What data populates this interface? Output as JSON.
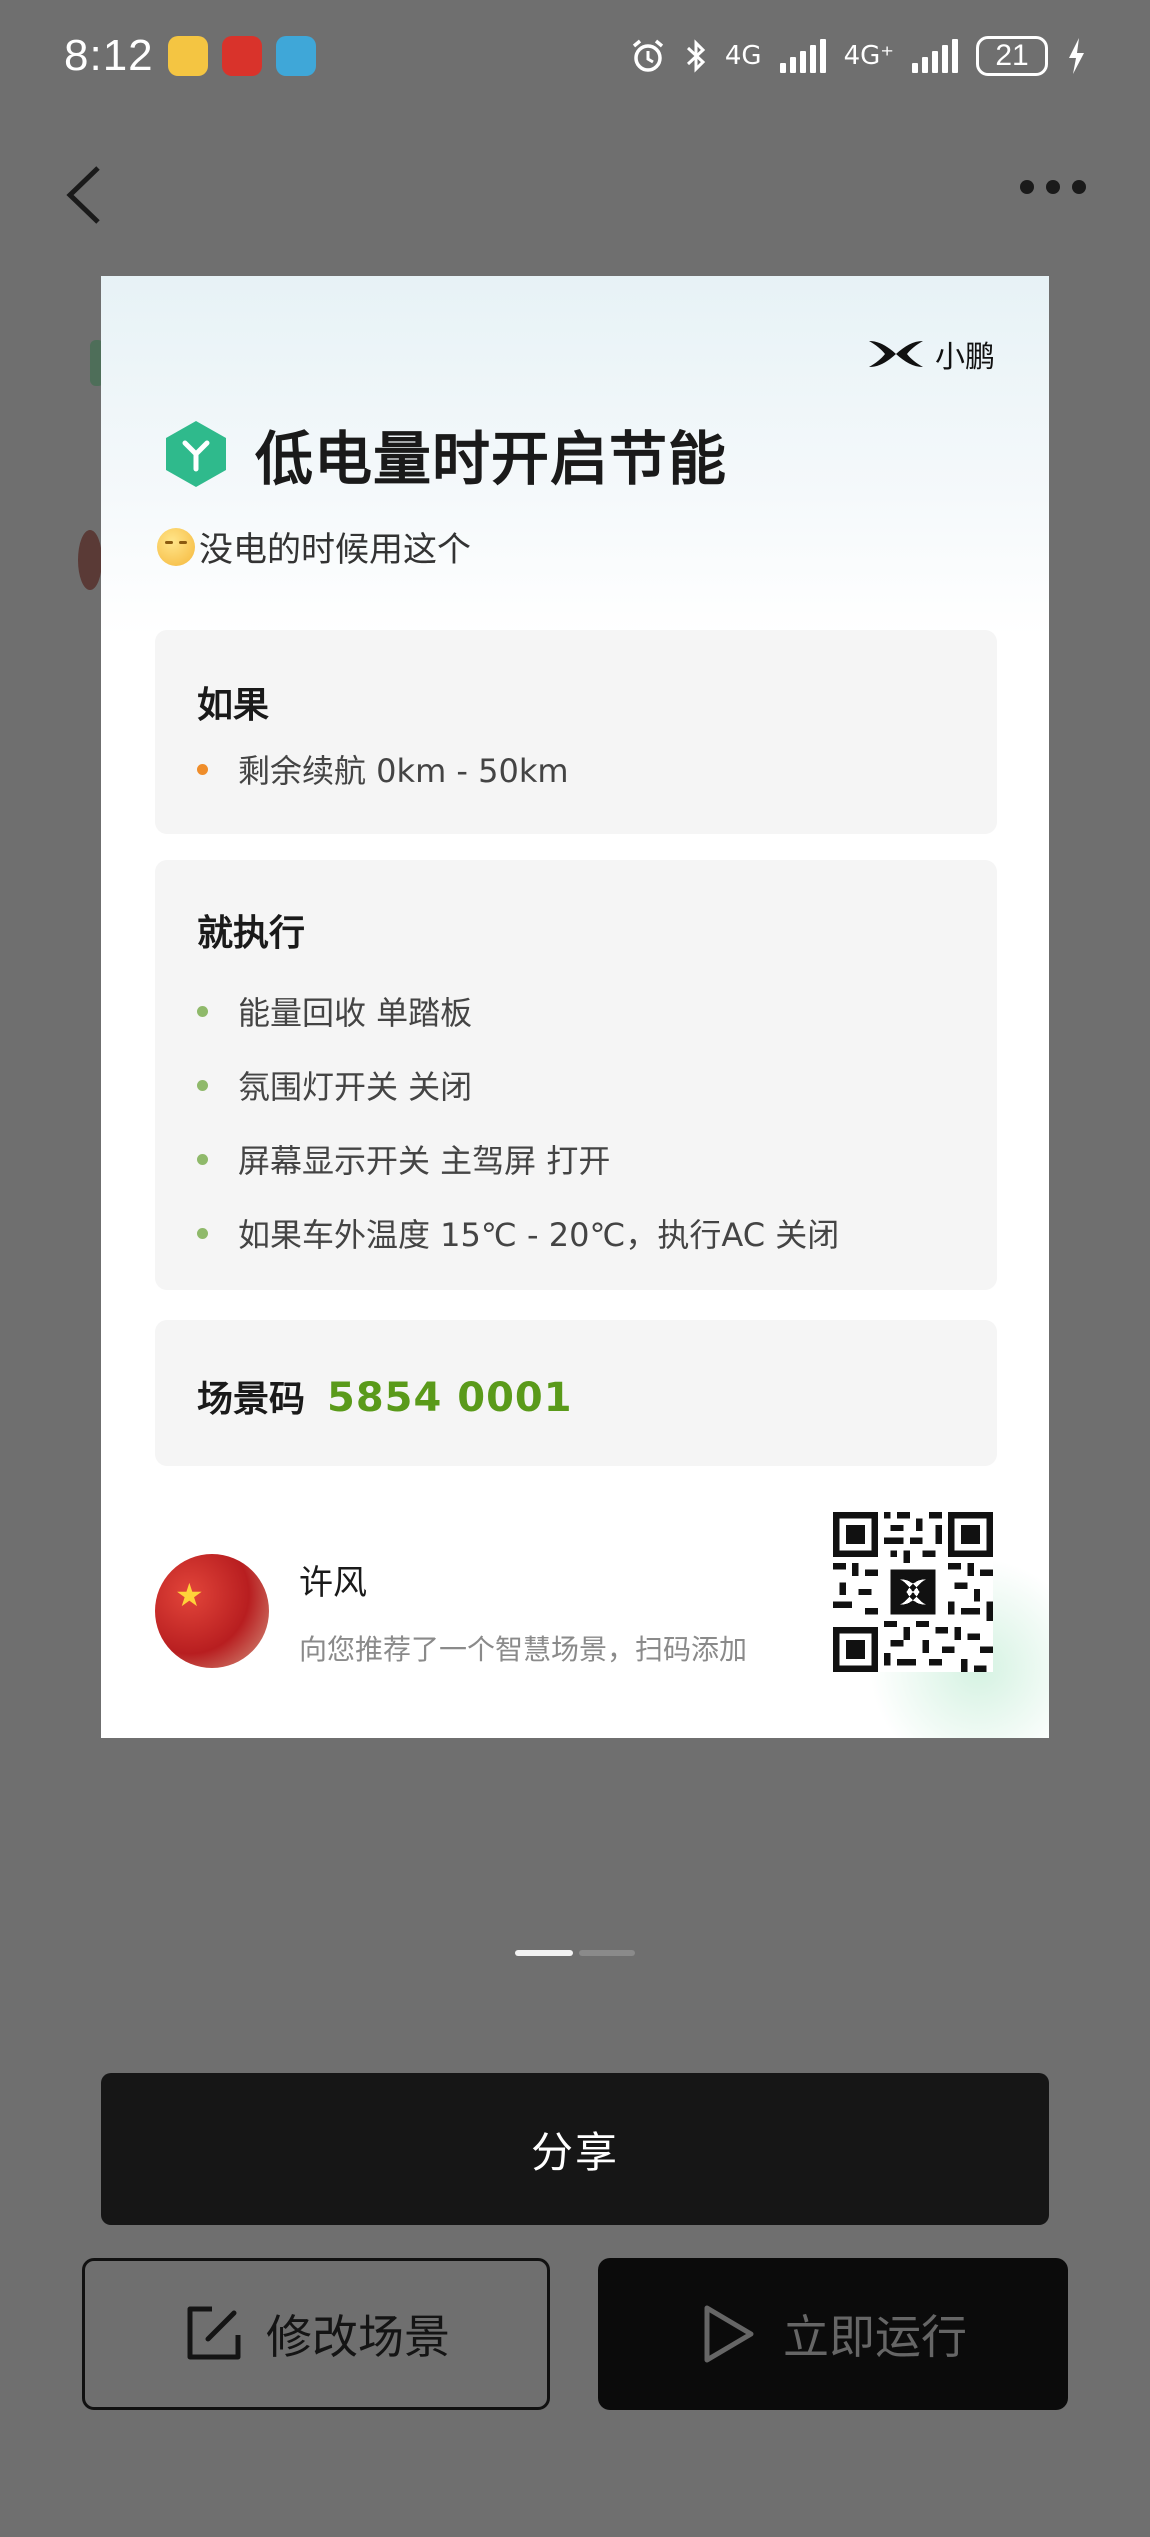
{
  "status_bar": {
    "time": "8:12",
    "network_1": "4G",
    "network_2": "4G⁺",
    "battery": "21"
  },
  "card": {
    "brand": "小鹏",
    "title": "低电量时开启节能",
    "subtitle": "没电的时候用这个",
    "if_section": {
      "heading": "如果",
      "conditions": [
        "剩余续航 0km - 50km"
      ]
    },
    "then_section": {
      "heading": "就执行",
      "actions": [
        "能量回收 单踏板",
        "氛围灯开关 关闭",
        "屏幕显示开关 主驾屏 打开",
        "如果车外温度 15℃ - 20℃，执行AC 关闭"
      ]
    },
    "scene_code": {
      "label": "场景码",
      "value": "5854 0001"
    },
    "sharer": {
      "name": "许风",
      "description": "向您推荐了一个智慧场景，扫码添加"
    }
  },
  "pager": {
    "count": 2,
    "active": 0
  },
  "buttons": {
    "share": "分享",
    "edit": "修改场景",
    "run": "立即运行"
  },
  "colors": {
    "accent_green": "#5a9a1a",
    "hex_icon_green": "#2fba8c",
    "condition_bullet": "#ef8d2a",
    "action_bullet": "#8fb96a",
    "overlay": "#6f6f6f"
  },
  "icons": [
    "back-arrow-icon",
    "more-dots-icon",
    "hexagon-scene-icon",
    "xpeng-logo-icon",
    "edit-icon",
    "play-icon",
    "alarm-icon",
    "bluetooth-icon",
    "charging-icon"
  ]
}
